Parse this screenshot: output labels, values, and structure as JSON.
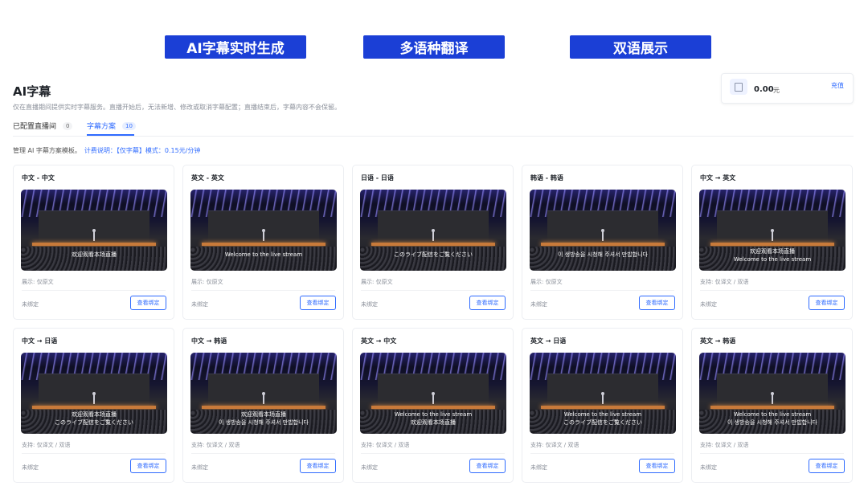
{
  "banners": [
    "AI字幕实时生成",
    "多语种翻译",
    "双语展示"
  ],
  "page": {
    "title": "AI字幕",
    "description": "仅在直播期间提供实时字幕服务。直播开始后，无法新增、修改或取消字幕配置；直播结束后，字幕内容不会保留。"
  },
  "balance": {
    "amount": "0.00",
    "unit": "元",
    "recharge_label": "充值"
  },
  "tabs": [
    {
      "label": "已配置直播间",
      "count": "0"
    },
    {
      "label": "字幕方案",
      "count": "10"
    }
  ],
  "info": {
    "text": "管理 AI 字幕方案模板。",
    "billing": "计费说明：【仅字幕】模式：0.15元/分钟"
  },
  "cards": [
    {
      "title": "中文 - 中文",
      "subtitles": [
        "欢迎观看本场直播"
      ],
      "mode": "展示: 仅原文",
      "status": "未绑定",
      "button": "查看绑定"
    },
    {
      "title": "英文 - 英文",
      "subtitles": [
        "Welcome to the live stream"
      ],
      "mode": "展示: 仅原文",
      "status": "未绑定",
      "button": "查看绑定"
    },
    {
      "title": "日语 - 日语",
      "subtitles": [
        "このライブ配信をご覧ください"
      ],
      "mode": "展示: 仅原文",
      "status": "未绑定",
      "button": "查看绑定"
    },
    {
      "title": "韩语 - 韩语",
      "subtitles": [
        "이 생방송을 시청해 주셔서 만밥합니다"
      ],
      "mode": "展示: 仅原文",
      "status": "未绑定",
      "button": "查看绑定"
    },
    {
      "title": "中文 → 英文",
      "subtitles": [
        "欢迎观看本场直播",
        "Welcome to the live stream"
      ],
      "mode": "支持: 仅译文 / 双语",
      "status": "未绑定",
      "button": "查看绑定"
    },
    {
      "title": "中文 → 日语",
      "subtitles": [
        "欢迎观看本场直播",
        "このライブ配信をご覧ください"
      ],
      "mode": "支持: 仅译文 / 双语",
      "status": "未绑定",
      "button": "查看绑定"
    },
    {
      "title": "中文 → 韩语",
      "subtitles": [
        "欢迎观看本场直播",
        "이 생방송을 시청해 주셔서 만밥합니다"
      ],
      "mode": "支持: 仅译文 / 双语",
      "status": "未绑定",
      "button": "查看绑定"
    },
    {
      "title": "英文 → 中文",
      "subtitles": [
        "Welcome to the live stream",
        "欢迎观看本场直播"
      ],
      "mode": "支持: 仅译文 / 双语",
      "status": "未绑定",
      "button": "查看绑定"
    },
    {
      "title": "英文 → 日语",
      "subtitles": [
        "Welcome to the live stream",
        "このライブ配信をご覧ください"
      ],
      "mode": "支持: 仅译文 / 双语",
      "status": "未绑定",
      "button": "查看绑定"
    },
    {
      "title": "英文 → 韩语",
      "subtitles": [
        "Welcome to the live stream",
        "이 생방송을 시청해 주셔서 만밥합니다"
      ],
      "mode": "支持: 仅译文 / 双语",
      "status": "未绑定",
      "button": "查看绑定"
    }
  ],
  "colors": {
    "banner": "#1b3fd6",
    "accent": "#2f6bff"
  }
}
